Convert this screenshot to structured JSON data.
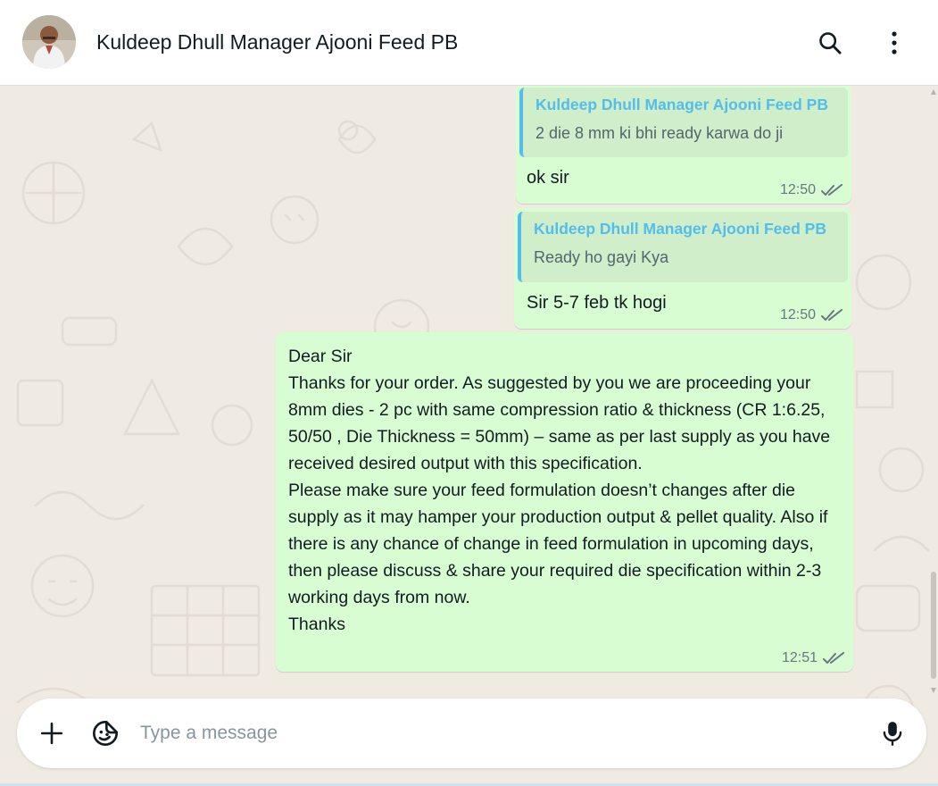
{
  "header": {
    "contact_name": "Kuldeep Dhull Manager Ajooni Feed PB",
    "search_icon": "search-icon",
    "menu_icon": "kebab-menu-icon"
  },
  "messages": [
    {
      "quote": {
        "author": "Kuldeep Dhull Manager Ajooni Feed PB",
        "text": "2 die 8 mm ki bhi ready karwa do ji"
      },
      "text": "ok sir",
      "time": "12:50",
      "status": "read"
    },
    {
      "quote": {
        "author": "Kuldeep Dhull Manager Ajooni Feed PB",
        "text": "Ready ho gayi Kya"
      },
      "text": "Sir 5-7 feb tk hogi",
      "time": "12:50",
      "status": "read"
    },
    {
      "text": "Dear Sir\nThanks for your order. As suggested by you we are proceeding your 8mm dies - 2 pc with same compression ratio & thickness (CR 1:6.25, 50/50 , Die Thickness = 50mm) – same as per last supply as you have received desired output with this specification.\nPlease make sure your feed formulation doesn’t changes after die supply as it may hamper your production output & pellet quality. Also if there is any chance of change in feed formulation in upcoming days, then please discuss & share your required die specification within 2-3 working days from now.\nThanks",
      "time": "12:51",
      "status": "read"
    }
  ],
  "composer": {
    "placeholder": "Type a message",
    "value": "",
    "attach_icon": "plus-icon",
    "sticker_icon": "sticker-icon",
    "mic_icon": "microphone-icon"
  },
  "colors": {
    "outgoing_bubble": "#d9fdd3",
    "quote_accent": "#53bdeb",
    "chat_background": "#efeae2"
  }
}
